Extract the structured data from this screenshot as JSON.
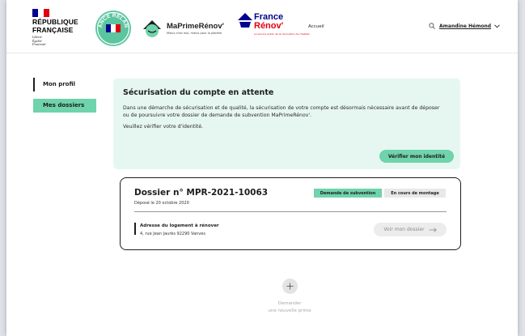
{
  "header": {
    "gov_title": "RÉPUBLIQUE\nFRANÇAISE",
    "gov_motto": "Liberté\nÉgalité\nFraternité",
    "relance_logo_text": "FRANCE RELANCE",
    "mpr_title": "MaPrimeRénov'",
    "mpr_subtitle": "Mieux chez moi, mieux pour la planète",
    "france_renov_line1": "France",
    "france_renov_line2": "Rénov'",
    "france_renov_subtitle": "Le service public de la rénovation de l'habitat",
    "nav_accueil": "Accueil",
    "user_name": "Amandine Hémond"
  },
  "sidebar": {
    "items": [
      {
        "label": "Mon profil"
      },
      {
        "label": "Mes dossiers"
      }
    ]
  },
  "alert": {
    "title": "Sécurisation du compte en attente",
    "text": "Dans une démarche de sécurisation et de qualité, la sécurisation de votre compte est désormais nécessaire avant de déposer ou de poursuivre votre dossier de demande de subvention MaPrimeRénov'.",
    "text2": "Veuillez vérifier votre d'identité.",
    "button": "Vérifier mon identité"
  },
  "dossier": {
    "number": "Dossier n° MPR-2021-10063",
    "date": "Déposé le 20 octobre 2020",
    "badge_type": "Demande de subvention",
    "badge_status": "En cours de montage",
    "address_label": "Adresse du logement à rénover",
    "address_value": "4, rue Jean Jaurès 92290 Vanves",
    "view_button": "Voir mon dossier"
  },
  "new_prime": {
    "label": "Demander\nune nouvelle prime"
  },
  "colors": {
    "accent_green": "#6fd3ac",
    "alert_bg": "#e6f7f2",
    "gov_blue": "#000091",
    "gov_red": "#e1000f"
  },
  "icons": {
    "user": "user-icon",
    "chevron": "chevron-down-icon",
    "arrow": "arrow-right-icon",
    "plus": "plus-icon"
  }
}
